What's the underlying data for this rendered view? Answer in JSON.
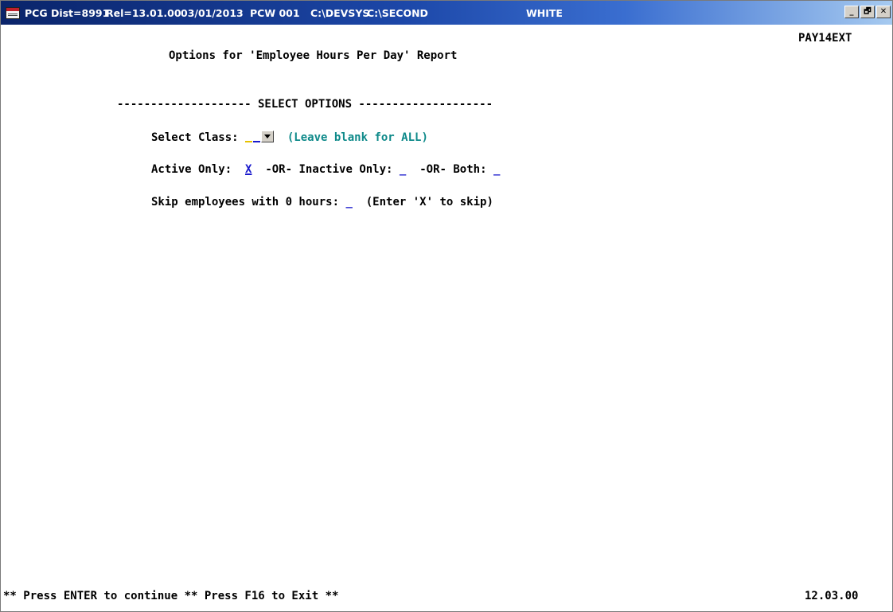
{
  "titlebar": {
    "dist": "PCG Dist=8991",
    "rel": "Rel=13.01.00",
    "date": "03/01/2013",
    "pcw": "PCW 001",
    "path1": "C:\\DEVSYS",
    "path2": "C:\\SECOND",
    "color": "WHITE",
    "buttons": {
      "minimize": "_",
      "restore": "🗗",
      "close": "✕"
    }
  },
  "screen": {
    "program_id": "PAY14EXT",
    "title": "Options for 'Employee Hours Per Day' Report",
    "section_header": "-------------------- SELECT OPTIONS --------------------",
    "select_class": {
      "label": "Select Class:",
      "value": "",
      "hint": "(Leave blank for ALL)"
    },
    "status": {
      "active_label": "Active Only:",
      "active_value": "X",
      "or_1": "-OR-",
      "inactive_label": "Inactive Only:",
      "inactive_value": "_",
      "or_2": "-OR-",
      "both_label": "Both:",
      "both_value": "_"
    },
    "skip_zero": {
      "label": "Skip employees with 0 hours:",
      "value": "_",
      "hint": "(Enter 'X' to skip)"
    },
    "footer": {
      "prompt": "** Press ENTER to continue ** Press F16 to Exit **",
      "version": "12.03.00"
    }
  },
  "colors": {
    "field": "#1a1acc",
    "hint": "#0f8a8a",
    "titlebar": "#0a246a"
  }
}
